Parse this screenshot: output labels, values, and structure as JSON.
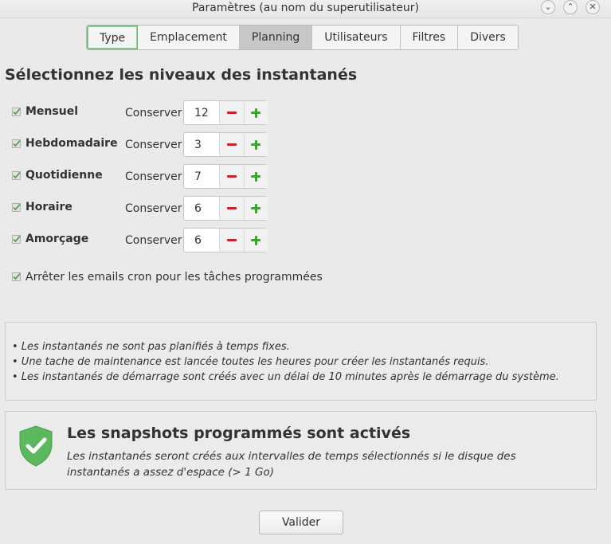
{
  "window": {
    "title": "Paramètres (au nom du superutilisateur)",
    "controls": [
      "chevron-down-icon",
      "chevron-up-icon",
      "close-icon"
    ]
  },
  "tabs": [
    {
      "label": "Type"
    },
    {
      "label": "Emplacement"
    },
    {
      "label": "Planning",
      "selected": true
    },
    {
      "label": "Utilisateurs"
    },
    {
      "label": "Filtres"
    },
    {
      "label": "Divers"
    }
  ],
  "schedule": {
    "heading": "Sélectionnez les niveaux des instantanés",
    "keep_label": "Conserver",
    "levels": [
      {
        "label": "Mensuel",
        "checked": true,
        "value": "12"
      },
      {
        "label": "Hebdomadaire",
        "checked": true,
        "value": "3"
      },
      {
        "label": "Quotidienne",
        "checked": true,
        "value": "7"
      },
      {
        "label": "Horaire",
        "checked": true,
        "value": "6"
      },
      {
        "label": "Amorçage",
        "checked": true,
        "value": "6"
      }
    ],
    "cron_label": "Arrêter les emails cron pour les tâches programmées",
    "cron_checked": true
  },
  "info": {
    "lines": [
      "• Les instantanés ne sont pas planifiés à temps fixes.",
      "• Une tache de maintenance est lancée toutes les heures pour créer les instantanés requis.",
      "• Les instantanés de démarrage sont créés avec un délai de 10 minutes après le démarrage du système."
    ]
  },
  "status": {
    "title": "Les snapshots programmés sont activés",
    "description": "Les instantanés seront créés aux intervalles de temps sélectionnés si le disque des instantanés a assez d'espace (> 1 Go)",
    "icon": "shield-check-icon",
    "accent": "#5cb85c"
  },
  "footer": {
    "ok_label": "Valider"
  },
  "colors": {
    "minus": "#d21e1e",
    "plus": "#3aa62e",
    "check": "#5a9e5a"
  }
}
